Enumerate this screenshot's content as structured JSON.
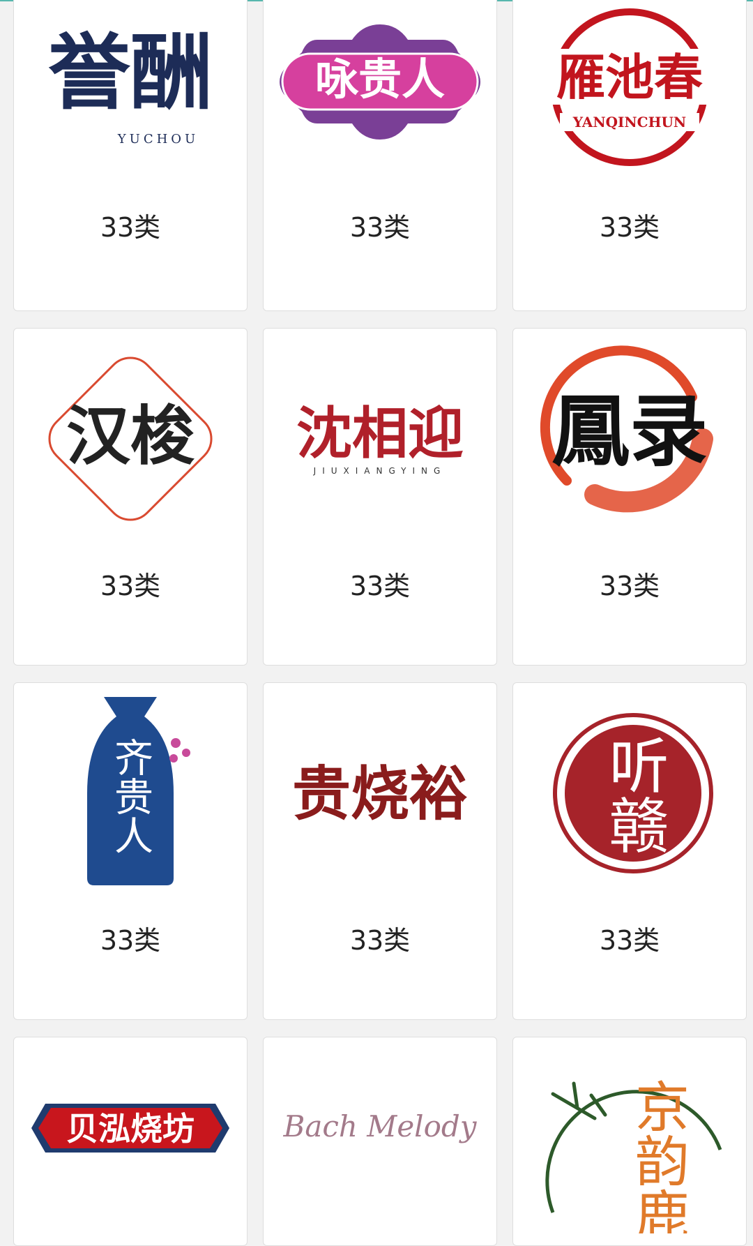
{
  "theme": {
    "navy": "#1d2c57",
    "magenta": "#d6409e",
    "purple": "#7a3f96",
    "red": "#c2151e",
    "darkred": "#a6232a",
    "orangered": "#e04a2a",
    "blue": "#1f4b8f",
    "maroon": "#8a1c1c",
    "orange": "#e07a2a",
    "green": "#2d5a2a",
    "mauve": "#a37a8a"
  },
  "cards": [
    {
      "name": "誉酬",
      "sub": "YUCHOU",
      "category": "33类",
      "icon": "yuchou-logo"
    },
    {
      "name": "咏贵人",
      "sub": "",
      "category": "33类",
      "icon": "yongguiren-logo"
    },
    {
      "name": "雁池春",
      "sub": "YANQINCHUN",
      "category": "33类",
      "icon": "yanchichun-logo"
    },
    {
      "name": "汉梭",
      "sub": "",
      "category": "33类",
      "icon": "hansuo-logo"
    },
    {
      "name": "沈相迎",
      "sub": "JIUXIANGYING",
      "category": "33类",
      "icon": "shenxiangying-logo"
    },
    {
      "name": "鳳录",
      "sub": "",
      "category": "33类",
      "icon": "fenglu-logo"
    },
    {
      "name": "齐贵人",
      "sub": "",
      "category": "33类",
      "icon": "qiguiren-logo"
    },
    {
      "name": "贵烧裕",
      "sub": "",
      "category": "33类",
      "icon": "guishaoyu-logo"
    },
    {
      "name": "听赣",
      "sub": "",
      "category": "33类",
      "icon": "tinggan-logo"
    },
    {
      "name": "贝泓烧坊",
      "sub": "",
      "category": "",
      "icon": "beihongshaofang-logo"
    },
    {
      "name": "Bach Melody",
      "sub": "",
      "category": "",
      "icon": "bach-melody-logo"
    },
    {
      "name": "京韵鹿",
      "sub": "",
      "category": "",
      "icon": "jingyunlu-logo"
    }
  ]
}
